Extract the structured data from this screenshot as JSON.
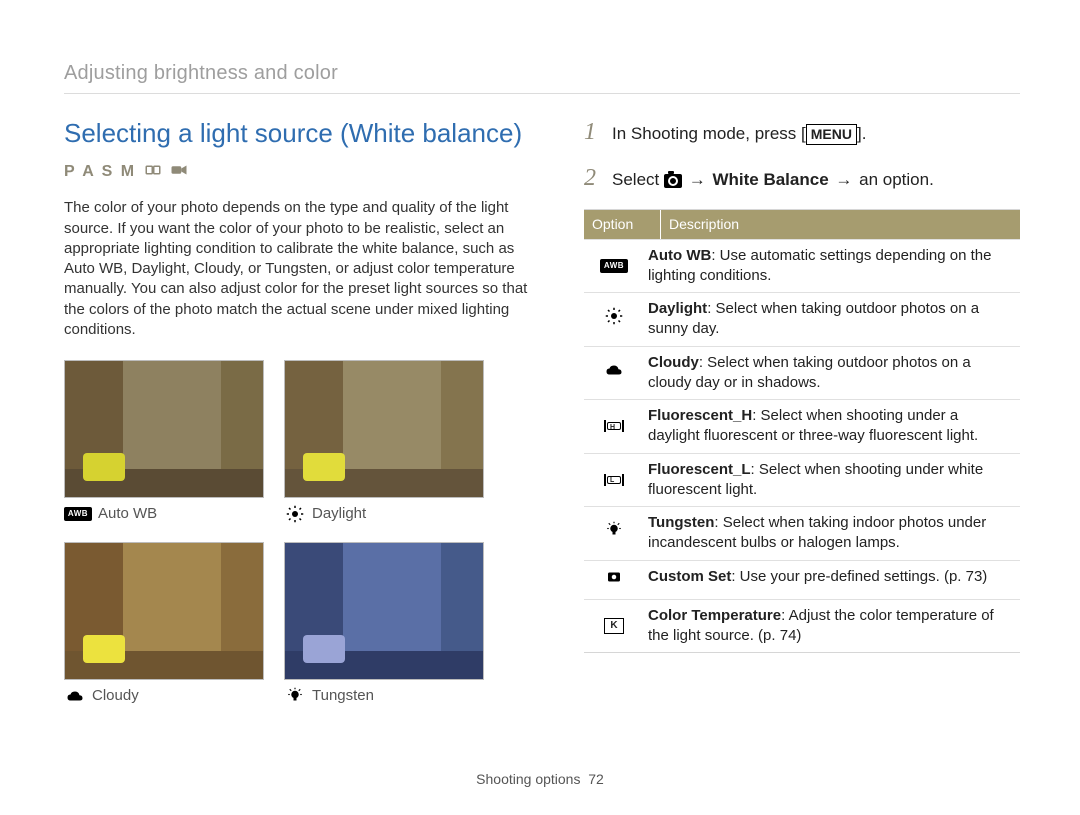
{
  "breadcrumb": "Adjusting brightness and color",
  "section_title": "Selecting a light source (White balance)",
  "modes": {
    "letters": "P A S M",
    "extra1": "DUAL",
    "extra2": ""
  },
  "body_text": "The color of your photo depends on the type and quality of the light source. If you want the color of your photo to be realistic, select an appropriate lighting condition to calibrate the white balance, such as Auto WB, Daylight, Cloudy, or Tungsten, or adjust color temperature manually. You can also adjust color for the preset light sources so that the colors of the photo match the actual scene under mixed lighting conditions.",
  "samples": [
    {
      "label": "Auto WB",
      "icon": "awb"
    },
    {
      "label": "Daylight",
      "icon": "sun"
    },
    {
      "label": "Cloudy",
      "icon": "cloud"
    },
    {
      "label": "Tungsten",
      "icon": "bulb"
    }
  ],
  "steps": {
    "s1": {
      "num": "1",
      "pre": "In Shooting mode, press [",
      "btn": "MENU",
      "post": "]."
    },
    "s2": {
      "num": "2",
      "pre": "Select ",
      "arrow": "→",
      "wb": "White Balance",
      "post": " an option."
    }
  },
  "table": {
    "head": {
      "c1": "Option",
      "c2": "Description"
    },
    "rows": [
      {
        "icon": "awb",
        "lead": "Auto WB",
        "text": ": Use automatic settings depending on the lighting conditions."
      },
      {
        "icon": "sun",
        "lead": "Daylight",
        "text": ": Select when taking outdoor photos on a sunny day."
      },
      {
        "icon": "cloud",
        "lead": "Cloudy",
        "text": ": Select when taking outdoor photos on a cloudy day or in shadows."
      },
      {
        "icon": "fluorH",
        "lead": "Fluorescent_H",
        "text": ": Select when shooting under a daylight fluorescent or three-way fluorescent light."
      },
      {
        "icon": "fluorL",
        "lead": "Fluorescent_L",
        "text": ": Select when shooting under white fluorescent light."
      },
      {
        "icon": "bulb",
        "lead": "Tungsten",
        "text": ": Select when taking indoor photos under incandescent bulbs or halogen lamps."
      },
      {
        "icon": "custom",
        "lead": "Custom Set",
        "text": ": Use your pre-defined settings. (p. 73)"
      },
      {
        "icon": "kbox",
        "lead": "Color Temperature",
        "text": ": Adjust the color temperature of the light source. (p. 74)"
      }
    ]
  },
  "footer": {
    "label": "Shooting options",
    "page": "72"
  },
  "icon_labels": {
    "awb": "AWB"
  }
}
